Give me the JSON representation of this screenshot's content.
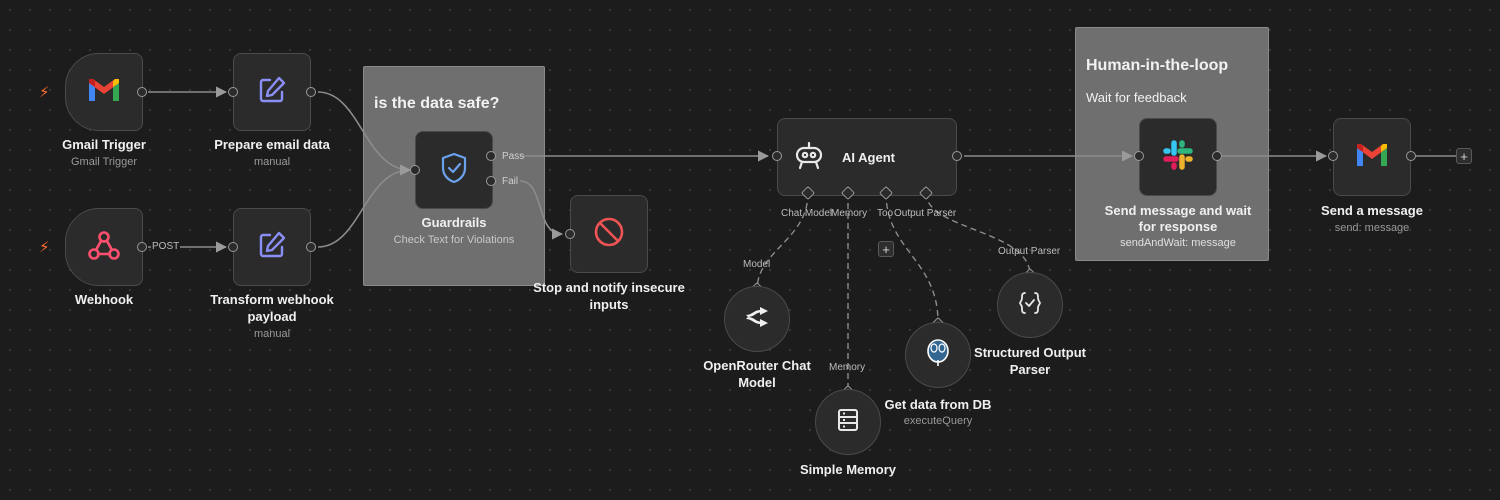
{
  "stickies": {
    "guard": {
      "title": "is the data safe?"
    },
    "human": {
      "title": "Human-in-the-loop",
      "subtitle": "Wait for feedback"
    }
  },
  "nodes": {
    "gmail_trigger": {
      "label": "Gmail Trigger",
      "sub": "Gmail Trigger",
      "icon": "gmail-icon"
    },
    "prepare_email": {
      "label": "Prepare email data",
      "sub": "manual",
      "icon": "edit-icon"
    },
    "webhook": {
      "label": "Webhook",
      "icon": "webhook-icon"
    },
    "transform_webhook": {
      "label_line1": "Transform webhook",
      "label_line2": "payload",
      "sub": "manual",
      "icon": "edit-icon"
    },
    "guardrails": {
      "label": "Guardrails",
      "sub": "Check Text for Violations",
      "pass": "Pass",
      "fail": "Fail",
      "icon": "shield-check-icon"
    },
    "stop_notify": {
      "label_line1": "Stop and notify insecure",
      "label_line2": "inputs",
      "icon": "stop-icon"
    },
    "ai_agent": {
      "label": "AI Agent",
      "icon": "robot-icon",
      "ports": {
        "chat_model": "Chat Model",
        "memory": "Memory",
        "tool": "Too",
        "output_parser": "Output Parser"
      }
    },
    "openrouter": {
      "label_line1": "OpenRouter Chat",
      "label_line2": "Model",
      "edge_label": "Model",
      "icon": "openrouter-icon"
    },
    "simple_memory": {
      "label": "Simple Memory",
      "edge_label": "Memory",
      "icon": "database-icon"
    },
    "get_data_db": {
      "label": "Get data from DB",
      "sub": "executeQuery",
      "icon": "postgres-icon"
    },
    "structured_parser": {
      "label_line1": "Structured Output",
      "label_line2": "Parser",
      "edge_label": "Output Parser",
      "icon": "braces-icon"
    },
    "slack_wait": {
      "label_line1": "Send message and wait",
      "label_line2": "for response",
      "sub": "sendAndWait: message",
      "icon": "slack-icon"
    },
    "send_message": {
      "label": "Send a message",
      "sub": "send: message",
      "icon": "gmail-icon"
    }
  },
  "edges": {
    "post_label": "POST"
  },
  "controls": {
    "add_symbol": "+"
  }
}
